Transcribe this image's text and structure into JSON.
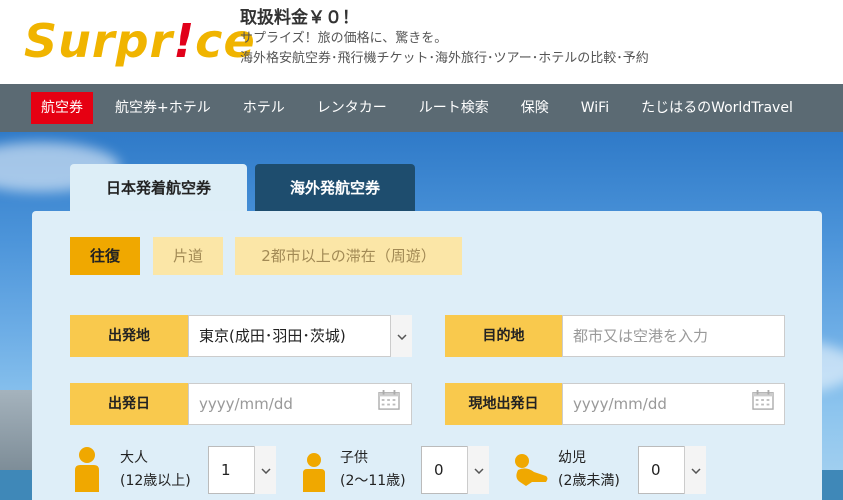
{
  "header": {
    "logo_main": "Surpr",
    "logo_ex": "!",
    "logo_tail": "ce",
    "title": "取扱料金￥０！",
    "subtitle": "サプライズ！旅の価格に、驚きを。",
    "description": "海外格安航空券･飛行機チケット･海外旅行･ツアー･ホテルの比較･予約"
  },
  "nav": {
    "items": [
      "航空券",
      "航空券+ホテル",
      "ホテル",
      "レンタカー",
      "ルート検索",
      "保険",
      "WiFi",
      "たじはるのWorldTravel"
    ]
  },
  "tabs": {
    "domestic": "日本発着航空券",
    "overseas": "海外発航空券"
  },
  "trip_type": {
    "round": "往復",
    "oneway": "片道",
    "multi": "2都市以上の滞在（周遊）"
  },
  "search": {
    "origin_label": "出発地",
    "origin_value": "東京(成田･羽田･茨城)",
    "destination_label": "目的地",
    "destination_placeholder": "都市又は空港を入力",
    "depart_label": "出発日",
    "depart_placeholder": "yyyy/mm/dd",
    "return_label": "現地出発日",
    "return_placeholder": "yyyy/mm/dd"
  },
  "passengers": {
    "adult_label": "大人",
    "adult_note": "(12歳以上)",
    "adult_value": "1",
    "child_label": "子供",
    "child_note": "(2～11歳)",
    "child_value": "0",
    "infant_label": "幼児",
    "infant_note": "(2歳未満)",
    "infant_value": "0"
  },
  "colors": {
    "accent": "#f9c94d",
    "nav_bg": "#5b6a73",
    "nav_active": "#e60012",
    "tab_dark": "#1e4d6e"
  },
  "icons": {
    "dropdown": "chevron-down-icon",
    "calendar": "calendar-icon",
    "adult": "adult-icon",
    "child": "child-icon",
    "infant": "infant-icon"
  }
}
